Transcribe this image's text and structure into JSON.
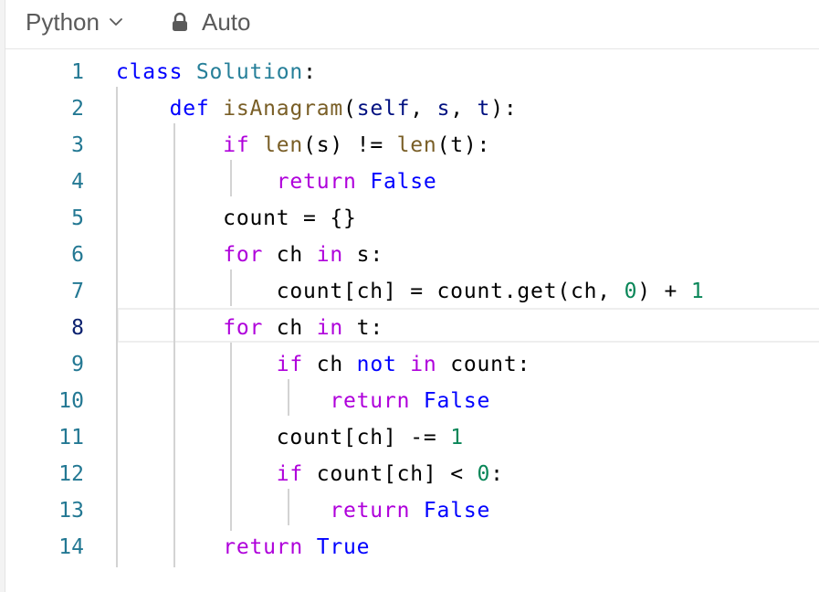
{
  "toolbar": {
    "language": "Python",
    "mode": "Auto"
  },
  "editor": {
    "current_line": 8,
    "lines": [
      {
        "n": "1",
        "tokens": [
          [
            "kw",
            "class"
          ],
          [
            "plain",
            " "
          ],
          [
            "cls",
            "Solution"
          ],
          [
            "plain",
            ":"
          ]
        ]
      },
      {
        "n": "2",
        "tokens": [
          [
            "plain",
            "    "
          ],
          [
            "kw",
            "def"
          ],
          [
            "plain",
            " "
          ],
          [
            "fn",
            "isAnagram"
          ],
          [
            "plain",
            "("
          ],
          [
            "var",
            "self"
          ],
          [
            "plain",
            ", "
          ],
          [
            "var",
            "s"
          ],
          [
            "plain",
            ", "
          ],
          [
            "var",
            "t"
          ],
          [
            "plain",
            "):"
          ]
        ]
      },
      {
        "n": "3",
        "tokens": [
          [
            "plain",
            "        "
          ],
          [
            "ctrl",
            "if"
          ],
          [
            "plain",
            " "
          ],
          [
            "fn",
            "len"
          ],
          [
            "plain",
            "(s) != "
          ],
          [
            "fn",
            "len"
          ],
          [
            "plain",
            "(t):"
          ]
        ]
      },
      {
        "n": "4",
        "tokens": [
          [
            "plain",
            "            "
          ],
          [
            "ctrl",
            "return"
          ],
          [
            "plain",
            " "
          ],
          [
            "kw",
            "False"
          ]
        ]
      },
      {
        "n": "5",
        "tokens": [
          [
            "plain",
            "        count = {}"
          ]
        ]
      },
      {
        "n": "6",
        "tokens": [
          [
            "plain",
            "        "
          ],
          [
            "ctrl",
            "for"
          ],
          [
            "plain",
            " ch "
          ],
          [
            "ctrl",
            "in"
          ],
          [
            "plain",
            " s:"
          ]
        ]
      },
      {
        "n": "7",
        "tokens": [
          [
            "plain",
            "            count[ch] = count.get(ch, "
          ],
          [
            "num",
            "0"
          ],
          [
            "plain",
            ") + "
          ],
          [
            "num",
            "1"
          ]
        ]
      },
      {
        "n": "8",
        "tokens": [
          [
            "plain",
            "        "
          ],
          [
            "ctrl",
            "for"
          ],
          [
            "plain",
            " ch "
          ],
          [
            "ctrl",
            "in"
          ],
          [
            "plain",
            " t:"
          ]
        ]
      },
      {
        "n": "9",
        "tokens": [
          [
            "plain",
            "            "
          ],
          [
            "ctrl",
            "if"
          ],
          [
            "plain",
            " ch "
          ],
          [
            "kw",
            "not"
          ],
          [
            "plain",
            " "
          ],
          [
            "ctrl",
            "in"
          ],
          [
            "plain",
            " count:"
          ]
        ]
      },
      {
        "n": "10",
        "tokens": [
          [
            "plain",
            "                "
          ],
          [
            "ctrl",
            "return"
          ],
          [
            "plain",
            " "
          ],
          [
            "kw",
            "False"
          ]
        ]
      },
      {
        "n": "11",
        "tokens": [
          [
            "plain",
            "            count[ch] -= "
          ],
          [
            "num",
            "1"
          ]
        ]
      },
      {
        "n": "12",
        "tokens": [
          [
            "plain",
            "            "
          ],
          [
            "ctrl",
            "if"
          ],
          [
            "plain",
            " count[ch] < "
          ],
          [
            "num",
            "0"
          ],
          [
            "plain",
            ":"
          ]
        ]
      },
      {
        "n": "13",
        "tokens": [
          [
            "plain",
            "                "
          ],
          [
            "ctrl",
            "return"
          ],
          [
            "plain",
            " "
          ],
          [
            "kw",
            "False"
          ]
        ]
      },
      {
        "n": "14",
        "tokens": [
          [
            "plain",
            "        "
          ],
          [
            "ctrl",
            "return"
          ],
          [
            "plain",
            " "
          ],
          [
            "kw",
            "True"
          ]
        ]
      }
    ]
  }
}
